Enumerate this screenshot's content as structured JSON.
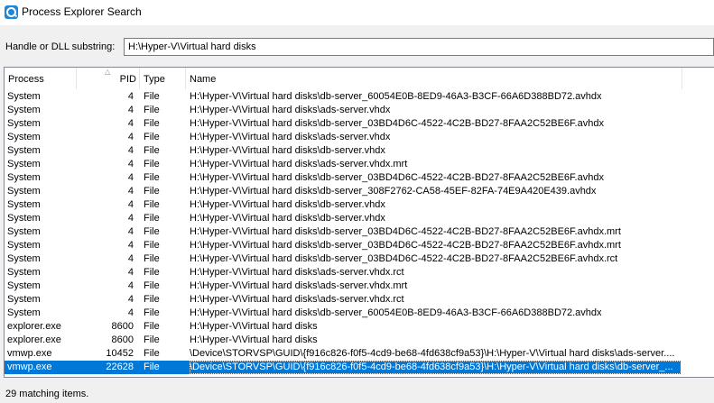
{
  "window": {
    "title": "Process Explorer Search"
  },
  "search": {
    "label": "Handle or DLL substring:",
    "value": "H:\\Hyper-V\\Virtual hard disks"
  },
  "columns": {
    "process": "Process",
    "pid": "PID",
    "type": "Type",
    "name": "Name"
  },
  "rows": [
    {
      "process": "System",
      "pid": "4",
      "type": "File",
      "name": "H:\\Hyper-V\\Virtual hard disks\\db-server_60054E0B-8ED9-46A3-B3CF-66A6D388BD72.avhdx"
    },
    {
      "process": "System",
      "pid": "4",
      "type": "File",
      "name": "H:\\Hyper-V\\Virtual hard disks\\ads-server.vhdx"
    },
    {
      "process": "System",
      "pid": "4",
      "type": "File",
      "name": "H:\\Hyper-V\\Virtual hard disks\\db-server_03BD4D6C-4522-4C2B-BD27-8FAA2C52BE6F.avhdx"
    },
    {
      "process": "System",
      "pid": "4",
      "type": "File",
      "name": "H:\\Hyper-V\\Virtual hard disks\\ads-server.vhdx"
    },
    {
      "process": "System",
      "pid": "4",
      "type": "File",
      "name": "H:\\Hyper-V\\Virtual hard disks\\db-server.vhdx"
    },
    {
      "process": "System",
      "pid": "4",
      "type": "File",
      "name": "H:\\Hyper-V\\Virtual hard disks\\ads-server.vhdx.mrt"
    },
    {
      "process": "System",
      "pid": "4",
      "type": "File",
      "name": "H:\\Hyper-V\\Virtual hard disks\\db-server_03BD4D6C-4522-4C2B-BD27-8FAA2C52BE6F.avhdx"
    },
    {
      "process": "System",
      "pid": "4",
      "type": "File",
      "name": "H:\\Hyper-V\\Virtual hard disks\\db-server_308F2762-CA58-45EF-82FA-74E9A420E439.avhdx"
    },
    {
      "process": "System",
      "pid": "4",
      "type": "File",
      "name": "H:\\Hyper-V\\Virtual hard disks\\db-server.vhdx"
    },
    {
      "process": "System",
      "pid": "4",
      "type": "File",
      "name": "H:\\Hyper-V\\Virtual hard disks\\db-server.vhdx"
    },
    {
      "process": "System",
      "pid": "4",
      "type": "File",
      "name": "H:\\Hyper-V\\Virtual hard disks\\db-server_03BD4D6C-4522-4C2B-BD27-8FAA2C52BE6F.avhdx.mrt"
    },
    {
      "process": "System",
      "pid": "4",
      "type": "File",
      "name": "H:\\Hyper-V\\Virtual hard disks\\db-server_03BD4D6C-4522-4C2B-BD27-8FAA2C52BE6F.avhdx.mrt"
    },
    {
      "process": "System",
      "pid": "4",
      "type": "File",
      "name": "H:\\Hyper-V\\Virtual hard disks\\db-server_03BD4D6C-4522-4C2B-BD27-8FAA2C52BE6F.avhdx.rct"
    },
    {
      "process": "System",
      "pid": "4",
      "type": "File",
      "name": "H:\\Hyper-V\\Virtual hard disks\\ads-server.vhdx.rct"
    },
    {
      "process": "System",
      "pid": "4",
      "type": "File",
      "name": "H:\\Hyper-V\\Virtual hard disks\\ads-server.vhdx.mrt"
    },
    {
      "process": "System",
      "pid": "4",
      "type": "File",
      "name": "H:\\Hyper-V\\Virtual hard disks\\ads-server.vhdx.rct"
    },
    {
      "process": "System",
      "pid": "4",
      "type": "File",
      "name": "H:\\Hyper-V\\Virtual hard disks\\db-server_60054E0B-8ED9-46A3-B3CF-66A6D388BD72.avhdx"
    },
    {
      "process": "explorer.exe",
      "pid": "8600",
      "type": "File",
      "name": "H:\\Hyper-V\\Virtual hard disks"
    },
    {
      "process": "explorer.exe",
      "pid": "8600",
      "type": "File",
      "name": "H:\\Hyper-V\\Virtual hard disks"
    },
    {
      "process": "vmwp.exe",
      "pid": "10452",
      "type": "File",
      "name": "\\Device\\STORVSP\\GUID\\{f916c826-f0f5-4cd9-be68-4fd638cf9a53}\\H:\\Hyper-V\\Virtual hard disks\\ads-server...."
    },
    {
      "process": "vmwp.exe",
      "pid": "22628",
      "type": "File",
      "name": "\\Device\\STORVSP\\GUID\\{f916c826-f0f5-4cd9-be68-4fd638cf9a53}\\H:\\Hyper-V\\Virtual hard disks\\db-server_...",
      "selected": true
    }
  ],
  "status": {
    "text": "29 matching items."
  },
  "colors": {
    "selection": "#0078d7",
    "app_icon": "#1e88d8"
  },
  "icons": {
    "app": "search-magnifier-icon",
    "sort": "sort-ascending-icon"
  }
}
